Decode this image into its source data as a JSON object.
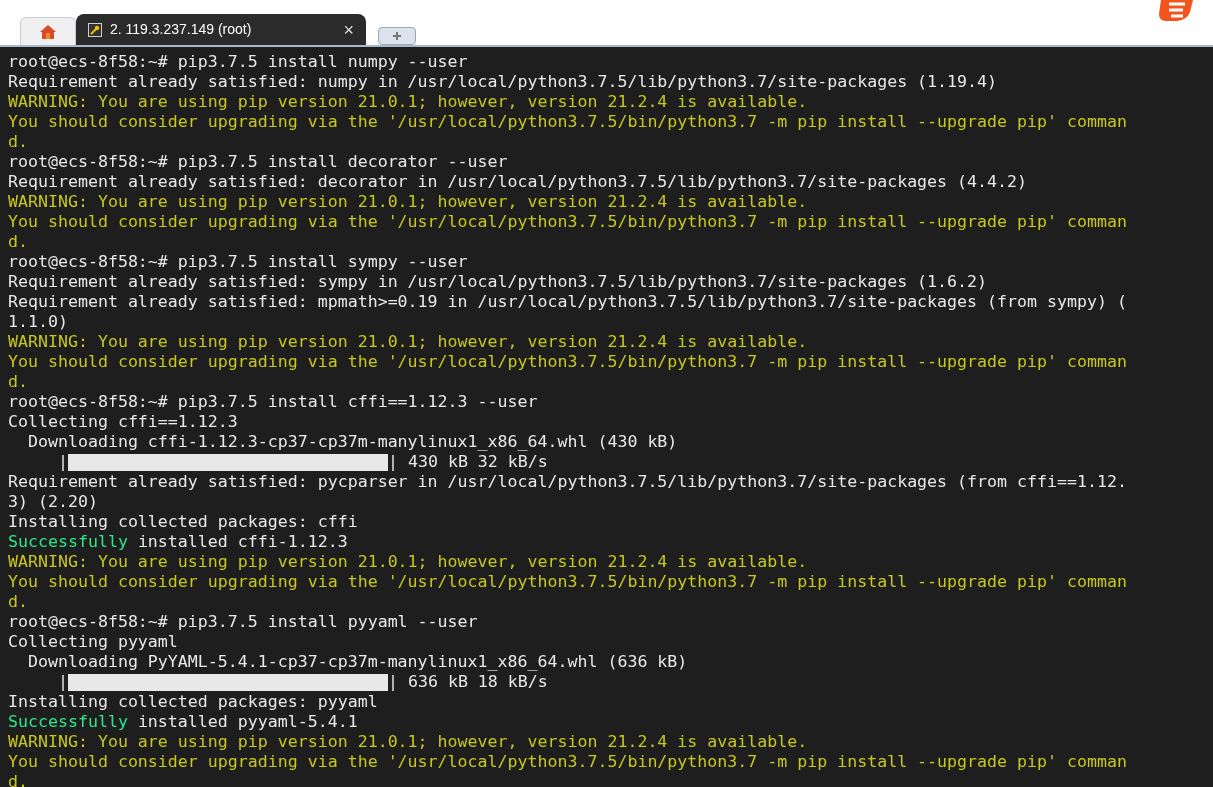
{
  "tabs": [
    {
      "kind": "home",
      "selected": false
    },
    {
      "kind": "session",
      "label": "2. 119.3.237.149 (root)",
      "close": "×",
      "selected": true
    },
    {
      "kind": "new",
      "selected": false
    }
  ],
  "terminal": {
    "lines": [
      [
        {
          "kind": "normal",
          "text": "root@ecs-8f58:~# pip3.7.5 install numpy --user"
        }
      ],
      [
        {
          "kind": "normal",
          "text": "Requirement already satisfied: numpy in /usr/local/python3.7.5/lib/python3.7/site-packages (1.19.4)"
        }
      ],
      [
        {
          "kind": "warn",
          "text": "WARNING: You are using pip version 21.0.1; however, version 21.2.4 is available."
        }
      ],
      [
        {
          "kind": "warn",
          "text": "You should consider upgrading via the '/usr/local/python3.7.5/bin/python3.7 -m pip install --upgrade pip' comman"
        }
      ],
      [
        {
          "kind": "warn",
          "text": "d."
        }
      ],
      [
        {
          "kind": "normal",
          "text": "root@ecs-8f58:~# pip3.7.5 install decorator --user"
        }
      ],
      [
        {
          "kind": "normal",
          "text": "Requirement already satisfied: decorator in /usr/local/python3.7.5/lib/python3.7/site-packages (4.4.2)"
        }
      ],
      [
        {
          "kind": "warn",
          "text": "WARNING: You are using pip version 21.0.1; however, version 21.2.4 is available."
        }
      ],
      [
        {
          "kind": "warn",
          "text": "You should consider upgrading via the '/usr/local/python3.7.5/bin/python3.7 -m pip install --upgrade pip' comman"
        }
      ],
      [
        {
          "kind": "warn",
          "text": "d."
        }
      ],
      [
        {
          "kind": "normal",
          "text": "root@ecs-8f58:~# pip3.7.5 install sympy --user"
        }
      ],
      [
        {
          "kind": "normal",
          "text": "Requirement already satisfied: sympy in /usr/local/python3.7.5/lib/python3.7/site-packages (1.6.2)"
        }
      ],
      [
        {
          "kind": "normal",
          "text": "Requirement already satisfied: mpmath>=0.19 in /usr/local/python3.7.5/lib/python3.7/site-packages (from sympy) ("
        }
      ],
      [
        {
          "kind": "normal",
          "text": "1.1.0)"
        }
      ],
      [
        {
          "kind": "warn",
          "text": "WARNING: You are using pip version 21.0.1; however, version 21.2.4 is available."
        }
      ],
      [
        {
          "kind": "warn",
          "text": "You should consider upgrading via the '/usr/local/python3.7.5/bin/python3.7 -m pip install --upgrade pip' comman"
        }
      ],
      [
        {
          "kind": "warn",
          "text": "d."
        }
      ],
      [
        {
          "kind": "normal",
          "text": "root@ecs-8f58:~# pip3.7.5 install cffi==1.12.3 --user"
        }
      ],
      [
        {
          "kind": "normal",
          "text": "Collecting cffi==1.12.3"
        }
      ],
      [
        {
          "kind": "normal",
          "text": "  Downloading cffi-1.12.3-cp37-cp37m-manylinux1_x86_64.whl (430 kB)"
        }
      ],
      [
        {
          "kind": "progress",
          "prefix": "     |",
          "level": 1,
          "suffix": "| 430 kB 32 kB/s"
        }
      ],
      [
        {
          "kind": "normal",
          "text": "Requirement already satisfied: pycparser in /usr/local/python3.7.5/lib/python3.7/site-packages (from cffi==1.12."
        }
      ],
      [
        {
          "kind": "normal",
          "text": "3) (2.20)"
        }
      ],
      [
        {
          "kind": "normal",
          "text": "Installing collected packages: cffi"
        }
      ],
      [
        {
          "kind": "success",
          "text": "Successfully"
        },
        {
          "kind": "normal",
          "text": " installed cffi-1.12.3"
        }
      ],
      [
        {
          "kind": "warn",
          "text": "WARNING: You are using pip version 21.0.1; however, version 21.2.4 is available."
        }
      ],
      [
        {
          "kind": "warn",
          "text": "You should consider upgrading via the '/usr/local/python3.7.5/bin/python3.7 -m pip install --upgrade pip' comman"
        }
      ],
      [
        {
          "kind": "warn",
          "text": "d."
        }
      ],
      [
        {
          "kind": "normal",
          "text": "root@ecs-8f58:~# pip3.7.5 install pyyaml --user"
        }
      ],
      [
        {
          "kind": "normal",
          "text": "Collecting pyyaml"
        }
      ],
      [
        {
          "kind": "normal",
          "text": "  Downloading PyYAML-5.4.1-cp37-cp37m-manylinux1_x86_64.whl (636 kB)"
        }
      ],
      [
        {
          "kind": "progress",
          "prefix": "     |",
          "level": 1,
          "suffix": "| 636 kB 18 kB/s"
        }
      ],
      [
        {
          "kind": "normal",
          "text": "Installing collected packages: pyyaml"
        }
      ],
      [
        {
          "kind": "success",
          "text": "Successfully"
        },
        {
          "kind": "normal",
          "text": " installed pyyaml-5.4.1"
        }
      ],
      [
        {
          "kind": "warn",
          "text": "WARNING: You are using pip version 21.0.1; however, version 21.2.4 is available."
        }
      ],
      [
        {
          "kind": "warn",
          "text": "You should consider upgrading via the '/usr/local/python3.7.5/bin/python3.7 -m pip install --upgrade pip' comman"
        }
      ],
      [
        {
          "kind": "warn",
          "text": "d."
        }
      ]
    ]
  }
}
